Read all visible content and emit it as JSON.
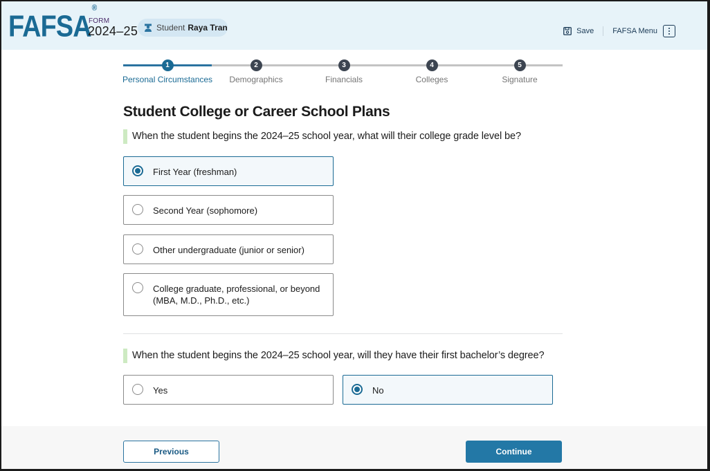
{
  "header": {
    "logo": "FAFSA",
    "logo_mark": "®",
    "form_label": "FORM",
    "form_year": "2024–25",
    "user_role": "Student",
    "user_name": "Raya Tran",
    "save_label": "Save",
    "menu_label": "FAFSA Menu",
    "icons": {
      "student": "student-graduate-icon",
      "save": "floppy-disk-icon",
      "menu": "kebab-menu-icon"
    }
  },
  "stepper": {
    "current_step": 1,
    "steps": [
      {
        "number": "1",
        "label": "Personal Circumstances"
      },
      {
        "number": "2",
        "label": "Demographics"
      },
      {
        "number": "3",
        "label": "Financials"
      },
      {
        "number": "4",
        "label": "Colleges"
      },
      {
        "number": "5",
        "label": "Signature"
      }
    ]
  },
  "page": {
    "title": "Student College or Career School Plans",
    "questions": [
      {
        "text": "When the student begins the 2024–25 school year, what will their college grade level be?",
        "selected": "First Year (freshman)",
        "options": [
          {
            "label_line1": "First Year (freshman)",
            "label_line2": ""
          },
          {
            "label_line1": "Second Year (sophomore)",
            "label_line2": ""
          },
          {
            "label_line1": "Other undergraduate (junior or senior)",
            "label_line2": ""
          },
          {
            "label_line1": "College graduate, professional, or beyond",
            "label_line2": "(MBA, M.D., Ph.D., etc.)"
          }
        ]
      },
      {
        "text": "When the student begins the 2024–25 school year, will they have their first bachelor’s degree?",
        "selected": "No",
        "options": [
          {
            "label_line1": "Yes"
          },
          {
            "label_line1": "No"
          }
        ]
      }
    ]
  },
  "footer": {
    "previous_label": "Previous",
    "continue_label": "Continue"
  },
  "colors": {
    "brand": "#1a6a94",
    "header_bg": "#e7f3f9",
    "question_accent": "#cdeac2",
    "continue_bg": "#2378a6"
  }
}
